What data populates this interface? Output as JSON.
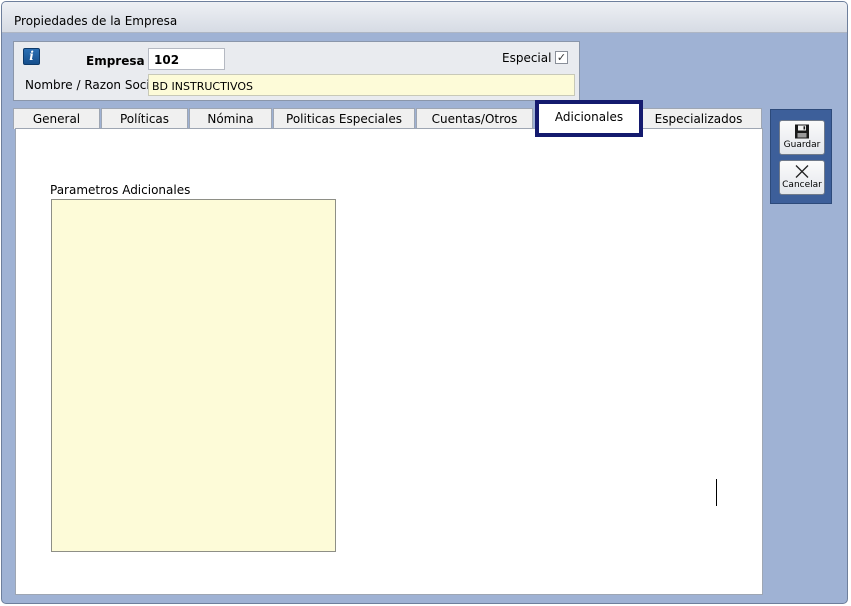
{
  "window": {
    "title": "Propiedades de la Empresa"
  },
  "header": {
    "empresa_label": "Empresa",
    "empresa_value": "102",
    "especial_label": "Especial",
    "especial_checked": true,
    "nombre_label": "Nombre / Razon Social",
    "nombre_value": "BD INSTRUCTIVOS",
    "info_icon": "information-icon"
  },
  "tabs": [
    {
      "label": "General",
      "active": false
    },
    {
      "label": "Políticas",
      "active": false
    },
    {
      "label": "Nómina",
      "active": false
    },
    {
      "label": "Politicas Especiales",
      "active": false
    },
    {
      "label": "Cuentas/Otros",
      "active": false
    },
    {
      "label": "Adicionales",
      "active": true
    },
    {
      "label": "Especializados",
      "active": false
    }
  ],
  "content": {
    "parametros_label": "Parametros Adicionales",
    "parametros_value": ""
  },
  "actions": {
    "guardar_label": "Guardar",
    "guardar_icon": "floppy-disk-icon",
    "cancelar_label": "Cancelar",
    "cancelar_icon": "cross-icon"
  },
  "colors": {
    "frame_background": "#9fb2d4",
    "input_yellow": "#fdfbd8",
    "active_tab_border": "#141a6e",
    "action_panel": "#3d5f9a"
  }
}
